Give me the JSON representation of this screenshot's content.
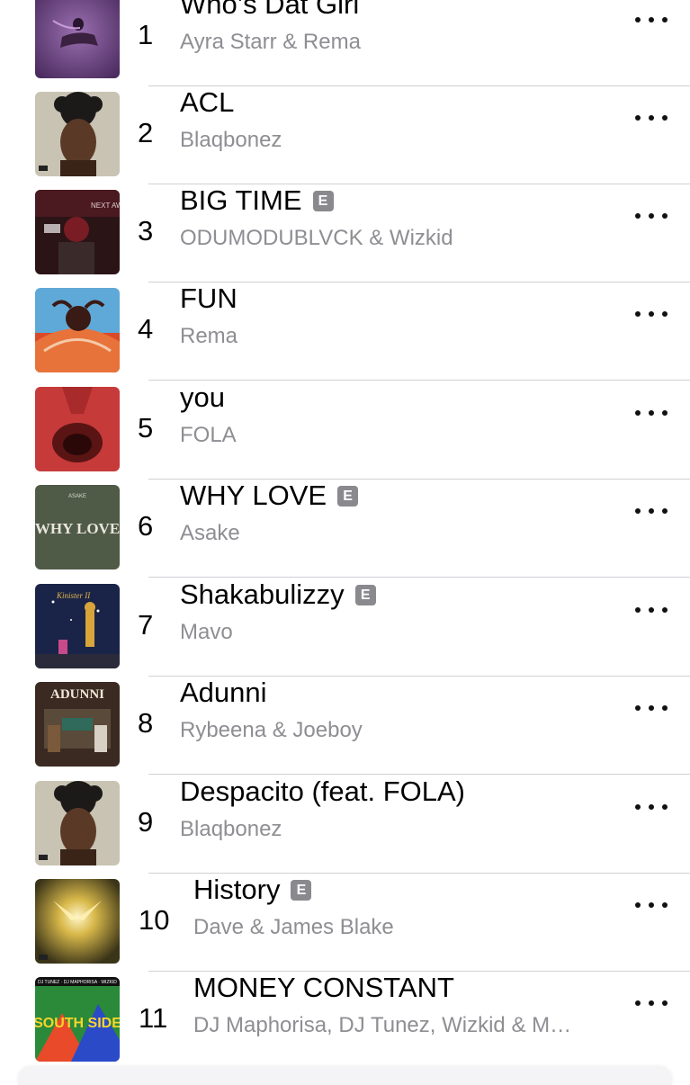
{
  "tracks": [
    {
      "rank": "1",
      "title": "Who’s Dat Girl",
      "artist": "Ayra Starr & Rema",
      "explicit": false
    },
    {
      "rank": "2",
      "title": "ACL",
      "artist": "Blaqbonez",
      "explicit": false
    },
    {
      "rank": "3",
      "title": "BIG TIME",
      "artist": "ODUMODUBLVCK & Wizkid",
      "explicit": true
    },
    {
      "rank": "4",
      "title": "FUN",
      "artist": "Rema",
      "explicit": false
    },
    {
      "rank": "5",
      "title": "you",
      "artist": "FOLA",
      "explicit": false
    },
    {
      "rank": "6",
      "title": "WHY LOVE",
      "artist": "Asake",
      "explicit": true
    },
    {
      "rank": "7",
      "title": "Shakabulizzy",
      "artist": "Mavo",
      "explicit": true
    },
    {
      "rank": "8",
      "title": "Adunni",
      "artist": "Rybeena & Joeboy",
      "explicit": false
    },
    {
      "rank": "9",
      "title": "Despacito (feat. FOLA)",
      "artist": "Blaqbonez",
      "explicit": false
    },
    {
      "rank": "10",
      "title": "History",
      "artist": "Dave & James Blake",
      "explicit": true
    },
    {
      "rank": "11",
      "title": "MONEY CONSTANT",
      "artist": "DJ Maphorisa, DJ Tunez, Wizkid & M…",
      "explicit": false
    }
  ],
  "explicit_label": "E",
  "artwork_text": {
    "t3": "NEXT AWARE",
    "t6": "WHY LOVE",
    "t6_small": "ASAKE",
    "t7": "Kinister II",
    "t8": "ADUNNI",
    "t11": "SOUTH SIDE",
    "t11_top": "DJ TUNEZ · DJ MAPHORISA · WIZKID"
  },
  "colors": {
    "artist_gray": "#8e8e93",
    "badge_gray": "#8a8a8e",
    "divider": "#d1d1d6"
  }
}
